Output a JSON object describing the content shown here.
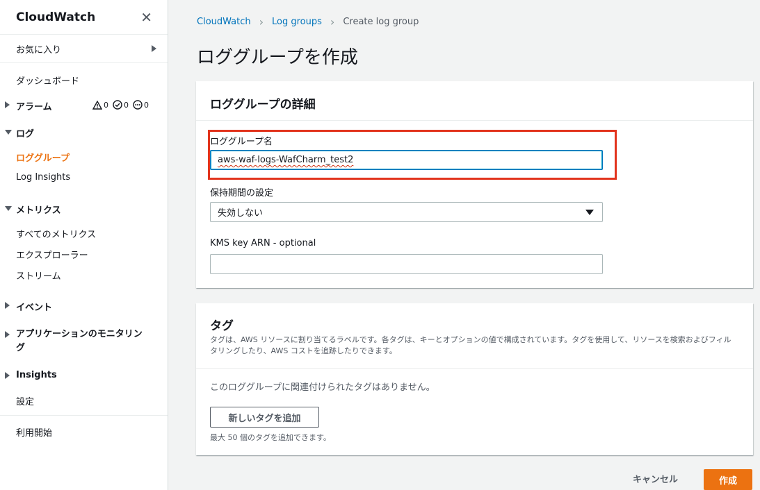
{
  "sidebar": {
    "title": "CloudWatch",
    "favorites": "お気に入り",
    "dashboard": "ダッシュボード",
    "alarms": "アラーム",
    "alarm_counts": {
      "alarm": "0",
      "ok": "0",
      "insufficient": "0"
    },
    "logs": "ログ",
    "log_groups": "ロググループ",
    "log_insights": "Log Insights",
    "metrics": "メトリクス",
    "all_metrics": "すべてのメトリクス",
    "explorer": "エクスプローラー",
    "streams": "ストリーム",
    "events": "イベント",
    "app_monitoring_line1": "アプリケーションのモニタリン",
    "app_monitoring_line2": "グ",
    "insights": "Insights",
    "settings": "設定",
    "getting_started": "利用開始"
  },
  "breadcrumb": {
    "items": [
      "CloudWatch",
      "Log groups"
    ],
    "current": "Create log group"
  },
  "page_title": "ロググループを作成",
  "details_panel": {
    "title": "ロググループの詳細",
    "name_label": "ロググループ名",
    "name_value": "aws-waf-logs-WafCharm_test2",
    "retention_label": "保持期間の設定",
    "retention_value": "失効しない",
    "kms_label": "KMS key ARN - optional",
    "kms_value": ""
  },
  "tags_panel": {
    "title": "タグ",
    "description": "タグは、AWS リソースに割り当てるラベルです。各タグは、キーとオプションの値で構成されています。タグを使用して、リソースを検索およびフィルタリングしたり、AWS コストを追跡したりできます。",
    "empty_text": "このロググループに関連付けられたタグはありません。",
    "add_button": "新しいタグを追加",
    "hint": "最大 50 個のタグを追加できます。"
  },
  "actions": {
    "cancel": "キャンセル",
    "create": "作成"
  },
  "colors": {
    "accent": "#ec7211",
    "link": "#0073bb",
    "highlight": "#e2341d"
  }
}
